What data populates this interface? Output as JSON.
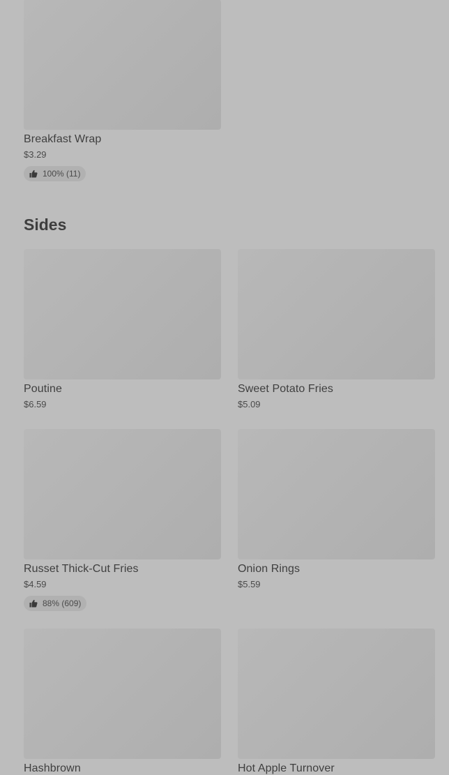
{
  "top_items": [
    {
      "name": "Breakfast Wrap",
      "price": "$3.29",
      "rating": "100% (11)"
    }
  ],
  "sides": {
    "title": "Sides",
    "items": [
      {
        "name": "Poutine",
        "price": "$6.59"
      },
      {
        "name": "Sweet Potato Fries",
        "price": "$5.09"
      },
      {
        "name": "Russet Thick-Cut Fries",
        "price": "$4.59",
        "rating": "88% (609)"
      },
      {
        "name": "Onion Rings",
        "price": "$5.59"
      },
      {
        "name": "Hashbrown"
      },
      {
        "name": "Hot Apple Turnover"
      }
    ]
  },
  "icons": {
    "rating": "thumbs-up-icon"
  }
}
